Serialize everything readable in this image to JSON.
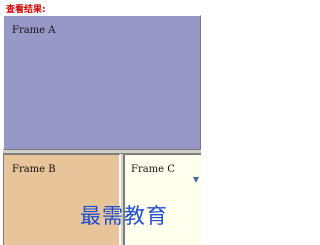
{
  "caption": "查看结果:",
  "frames": {
    "a": {
      "label": "Frame A"
    },
    "b": {
      "label": "Frame B"
    },
    "c": {
      "label": "Frame C"
    }
  },
  "watermark": "最需教育",
  "colors": {
    "caption": "#cc0000",
    "frame_a": "#9898c8",
    "frame_b": "#e8c49a",
    "frame_c": "#ffffee",
    "watermark": "#1f4fd0"
  }
}
